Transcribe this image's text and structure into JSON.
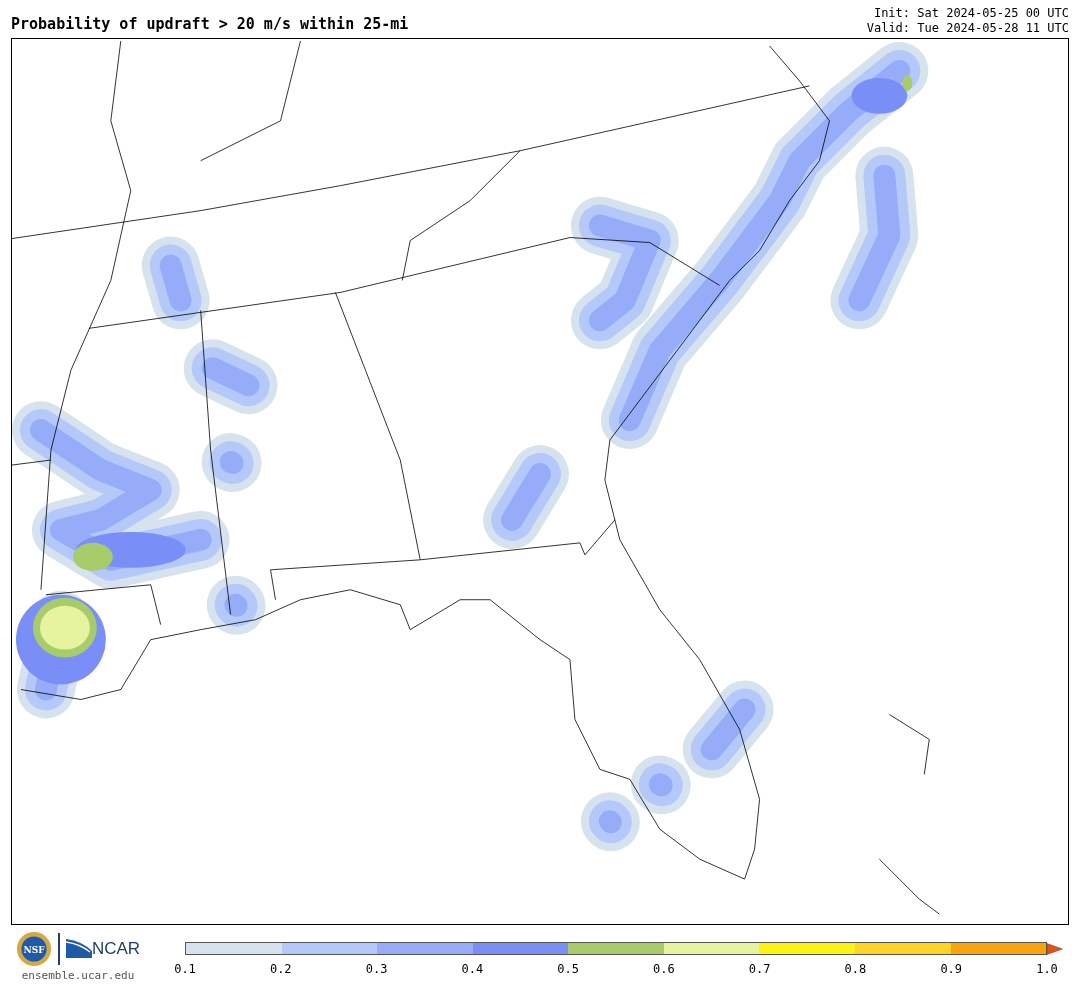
{
  "title": "Probability of updraft > 20 m/s within 25-mi",
  "init": "Init: Sat 2024-05-25 00 UTC",
  "valid": "Valid: Tue 2024-05-28 11 UTC",
  "logos": {
    "nsf": "NSF",
    "ncar": "NCAR"
  },
  "website": "ensemble.ucar.edu",
  "colorbar": {
    "segments": [
      {
        "color": "#d6e2ee"
      },
      {
        "color": "#b4c8fa"
      },
      {
        "color": "#96acf8"
      },
      {
        "color": "#7a8ef7"
      },
      {
        "color": "#a8cc6a"
      },
      {
        "color": "#e6f4a0"
      },
      {
        "color": "#fbf313"
      },
      {
        "color": "#fdd424"
      },
      {
        "color": "#fba30c"
      },
      {
        "color": "#e8500e",
        "kind": "arrow"
      }
    ],
    "ticks": [
      "0.1",
      "0.2",
      "0.3",
      "0.4",
      "0.5",
      "0.6",
      "0.7",
      "0.8",
      "0.9",
      "1.0"
    ]
  }
}
